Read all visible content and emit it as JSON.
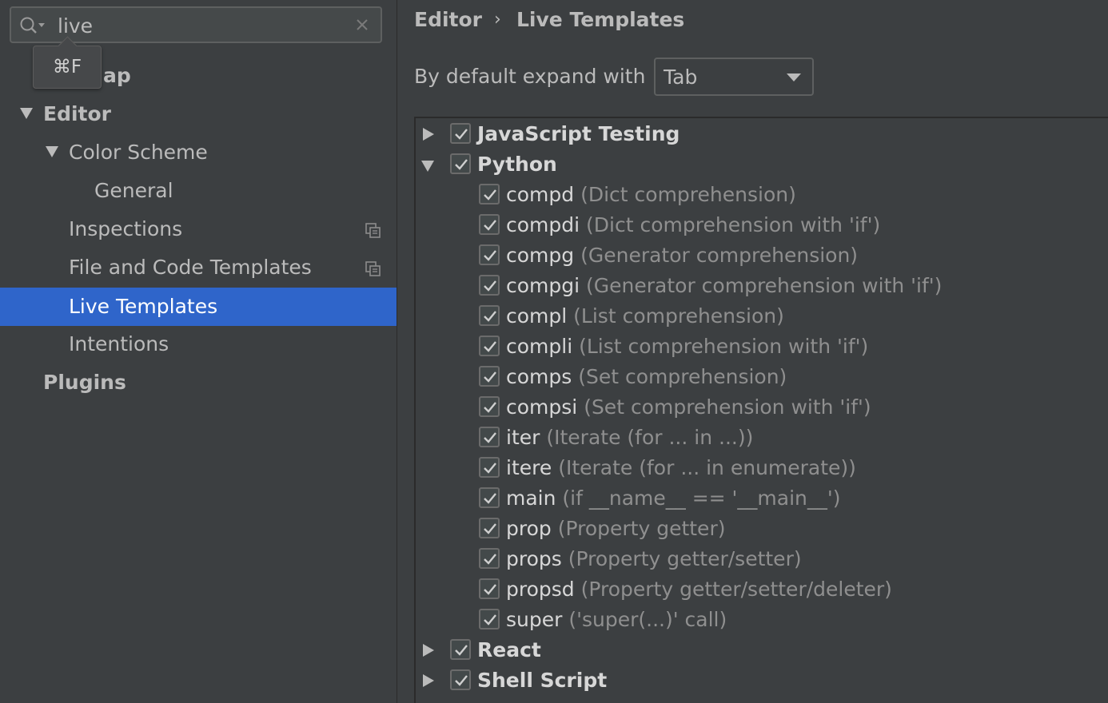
{
  "search": {
    "value": "live",
    "shortcut_hint": "⌘F"
  },
  "sidebar": {
    "items": [
      {
        "label": "ap"
      },
      {
        "label": "Editor"
      },
      {
        "label": "Color Scheme"
      },
      {
        "label": "General"
      },
      {
        "label": "Inspections"
      },
      {
        "label": "File and Code Templates"
      },
      {
        "label": "Live Templates"
      },
      {
        "label": "Intentions"
      },
      {
        "label": "Plugins"
      }
    ]
  },
  "breadcrumb": {
    "parent": "Editor",
    "separator": "›",
    "current": "Live Templates"
  },
  "expand": {
    "label": "By default expand with",
    "value": "Tab"
  },
  "templates": {
    "groups": [
      {
        "label": "JavaScript Testing",
        "checked": true,
        "expanded": false
      },
      {
        "label": "Python",
        "checked": true,
        "expanded": true
      },
      {
        "label": "React",
        "checked": true,
        "expanded": false
      },
      {
        "label": "Shell Script",
        "checked": true,
        "expanded": false
      }
    ],
    "python_items": [
      {
        "abbr": "compd",
        "desc": "(Dict comprehension)"
      },
      {
        "abbr": "compdi",
        "desc": "(Dict comprehension with 'if')"
      },
      {
        "abbr": "compg",
        "desc": "(Generator comprehension)"
      },
      {
        "abbr": "compgi",
        "desc": "(Generator comprehension with 'if')"
      },
      {
        "abbr": "compl",
        "desc": "(List comprehension)"
      },
      {
        "abbr": "compli",
        "desc": "(List comprehension with 'if')"
      },
      {
        "abbr": "comps",
        "desc": "(Set comprehension)"
      },
      {
        "abbr": "compsi",
        "desc": "(Set comprehension with 'if')"
      },
      {
        "abbr": "iter",
        "desc": "(Iterate (for ... in ...))"
      },
      {
        "abbr": "itere",
        "desc": "(Iterate (for ... in enumerate))"
      },
      {
        "abbr": "main",
        "desc": "(if __name__ == '__main__')"
      },
      {
        "abbr": "prop",
        "desc": "(Property getter)"
      },
      {
        "abbr": "props",
        "desc": "(Property getter/setter)"
      },
      {
        "abbr": "propsd",
        "desc": "(Property getter/setter/deleter)"
      },
      {
        "abbr": "super",
        "desc": "('super(...)' call)"
      }
    ]
  },
  "colors": {
    "background": "#3c3f41",
    "selection": "#2f65ca",
    "text": "#bbbbbb",
    "muted": "#8f8f8f"
  }
}
